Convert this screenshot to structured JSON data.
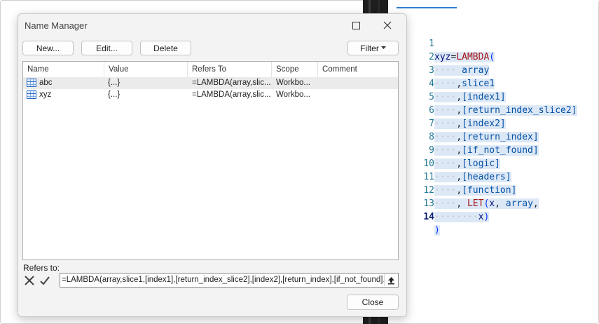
{
  "dialog": {
    "title": "Name Manager",
    "buttons": {
      "new": "New...",
      "edit": "Edit...",
      "delete": "Delete",
      "filter": "Filter",
      "close": "Close"
    },
    "columns": [
      "Name",
      "Value",
      "Refers To",
      "Scope",
      "Comment"
    ],
    "rows": [
      {
        "name": "abc",
        "value": "{...}",
        "refers_to": "=LAMBDA(array,slic...",
        "scope": "Workbo...",
        "comment": ""
      },
      {
        "name": "xyz",
        "value": "{...}",
        "refers_to": "=LAMBDA(array,slic...",
        "scope": "Workbo...",
        "comment": ""
      }
    ],
    "refers_to_label": "Refers to:",
    "refers_to_value": "=LAMBDA(array,slice1,[index1],[return_index_slice2],[index2],[return_index],[if_not_found],"
  },
  "editor": {
    "lines": [
      {
        "n": "1",
        "text": "xyz=LAMBDA("
      },
      {
        "n": "2",
        "text": "array"
      },
      {
        "n": "3",
        "text": ",slice1"
      },
      {
        "n": "4",
        "text": ",[index1]"
      },
      {
        "n": "5",
        "text": ",[return_index_slice2]"
      },
      {
        "n": "6",
        "text": ",[index2]"
      },
      {
        "n": "7",
        "text": ",[return_index]"
      },
      {
        "n": "8",
        "text": ",[if_not_found]"
      },
      {
        "n": "9",
        "text": ",[logic]"
      },
      {
        "n": "10",
        "text": ",[headers]"
      },
      {
        "n": "11",
        "text": ",[function]"
      },
      {
        "n": "12",
        "text": ", LET(x, array,"
      },
      {
        "n": "13",
        "text": "x)"
      },
      {
        "n": "14",
        "text": ")"
      }
    ],
    "active_line": "14"
  },
  "colors": {
    "accent": "#2f7dd1",
    "selection": "#dde8f6",
    "line_number": "#237893",
    "keyword": "#a31515"
  }
}
